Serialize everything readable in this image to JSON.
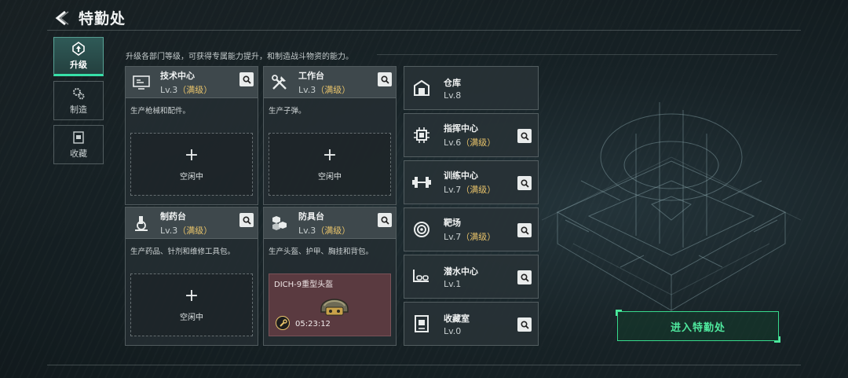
{
  "header": {
    "title": "特勤处",
    "back_icon": "back-arrow-icon"
  },
  "nav": {
    "items": [
      {
        "label": "升级",
        "icon": "upgrade-icon",
        "active": true
      },
      {
        "label": "制造",
        "icon": "gears-icon",
        "active": false
      },
      {
        "label": "收藏",
        "icon": "collection-icon",
        "active": false
      }
    ]
  },
  "subtitle": "升级各部门等级，可获得专属能力提升，和制造战斗物资的能力。",
  "cards": [
    {
      "name": "技术中心",
      "level": "Lv.3",
      "max": "（满级）",
      "desc": "生产枪械和配件。",
      "slot_plus": "+",
      "slot_label": "空闲中",
      "icon": "tech-center-icon"
    },
    {
      "name": "工作台",
      "level": "Lv.3",
      "max": "（满级）",
      "desc": "生产子弹。",
      "slot_plus": "+",
      "slot_label": "空闲中",
      "icon": "workbench-tools-icon"
    },
    {
      "name": "制药台",
      "level": "Lv.3",
      "max": "（满级）",
      "desc": "生产药品、针剂和维修工具包。",
      "slot_plus": "+",
      "slot_label": "空闲中",
      "icon": "microscope-icon"
    },
    {
      "name": "防具台",
      "level": "Lv.3",
      "max": "（满级）",
      "desc": "生产头盔、护甲、胸挂和背包。",
      "busy_item": "DICH-9重型头盔",
      "busy_time": "05:23:12",
      "icon": "armor-blocks-icon"
    }
  ],
  "rooms": [
    {
      "name": "仓库",
      "level": "Lv.8",
      "max": "",
      "icon": "warehouse-icon"
    },
    {
      "name": "指挥中心",
      "level": "Lv.6",
      "max": "（满级）",
      "icon": "command-chip-icon"
    },
    {
      "name": "训练中心",
      "level": "Lv.7",
      "max": "（满级）",
      "icon": "dumbbell-icon"
    },
    {
      "name": "靶场",
      "level": "Lv.7",
      "max": "（满级）",
      "icon": "target-icon"
    },
    {
      "name": "潜水中心",
      "level": "Lv.1",
      "max": "",
      "icon": "diving-icon"
    },
    {
      "name": "收藏室",
      "level": "Lv.0",
      "max": "",
      "icon": "collection-room-icon"
    }
  ],
  "enter_button": "进入特勤处",
  "colors": {
    "accent_green": "#37d98c",
    "max_gold": "#e8c36a",
    "busy_slot": "#5a3a40"
  }
}
